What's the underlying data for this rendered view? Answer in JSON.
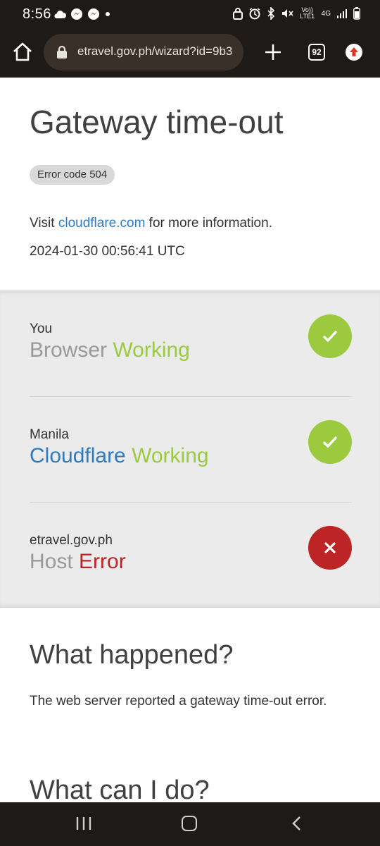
{
  "status_bar": {
    "time": "8:56",
    "left_icons": [
      "cloud-icon",
      "messenger-icon",
      "messenger-icon",
      "dot-icon"
    ],
    "right_icons": [
      "lock-icon",
      "alarm-icon",
      "bluetooth-icon",
      "mute-icon",
      "volte-icon",
      "signal-icon",
      "battery-icon"
    ],
    "volte_label": "Vo)) LTE1",
    "network_label": "4G"
  },
  "browser": {
    "url": "etravel.gov.ph/wizard?id=9b3",
    "tab_count": "92"
  },
  "page": {
    "title": "Gateway time-out",
    "error_badge": "Error code 504",
    "visit_prefix": "Visit ",
    "visit_link": "cloudflare.com",
    "visit_suffix": " for more information.",
    "timestamp": "2024-01-30 00:56:41 UTC",
    "nodes": [
      {
        "location": "You",
        "name": "Browser",
        "status": "Working",
        "ok": true
      },
      {
        "location": "Manila",
        "name": "Cloudflare",
        "status": "Working",
        "ok": true
      },
      {
        "location": "etravel.gov.ph",
        "name": "Host",
        "status": "Error",
        "ok": false
      }
    ],
    "what_happened_title": "What happened?",
    "what_happened_text": "The web server reported a gateway time-out error.",
    "what_can_i_do_title": "What can I do?"
  },
  "colors": {
    "ok": "#9bca3e",
    "error": "#bd2426",
    "link": "#2f7bbf",
    "bar_bg": "#1d1a17"
  }
}
